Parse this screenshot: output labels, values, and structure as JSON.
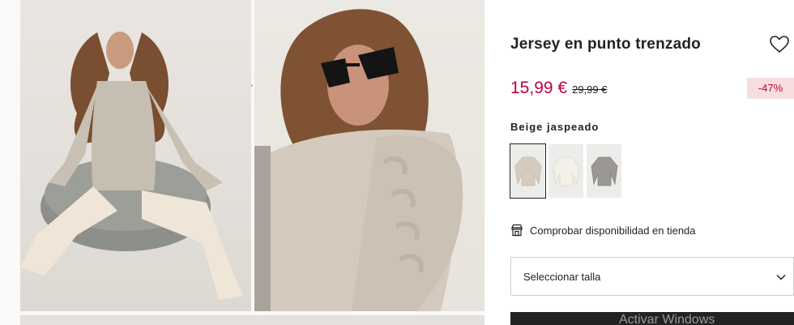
{
  "gallery": {
    "mark": "'"
  },
  "product": {
    "title": "Jersey en punto trenzado",
    "price_now": "15,99 €",
    "price_old": "29,99 €",
    "discount": "-47%",
    "color_name": "Beige jaspeado"
  },
  "swatches": [
    {
      "color": "#d5ccc0",
      "selected": true
    },
    {
      "color": "#f3f0e8",
      "selected": false
    },
    {
      "color": "#9b9893",
      "selected": false
    }
  ],
  "store": {
    "label": "Comprobar disponibilidad en tienda",
    "icon": "store-icon"
  },
  "size": {
    "label": "Seleccionar talla",
    "icon": "chevron-down-icon"
  },
  "wishlist": {
    "icon": "heart-icon"
  },
  "overlay": {
    "watermark": "Activar Windows"
  },
  "colors": {
    "sale": "#c2003b",
    "discount_bg": "#f7dede",
    "button_dark": "#222222"
  }
}
